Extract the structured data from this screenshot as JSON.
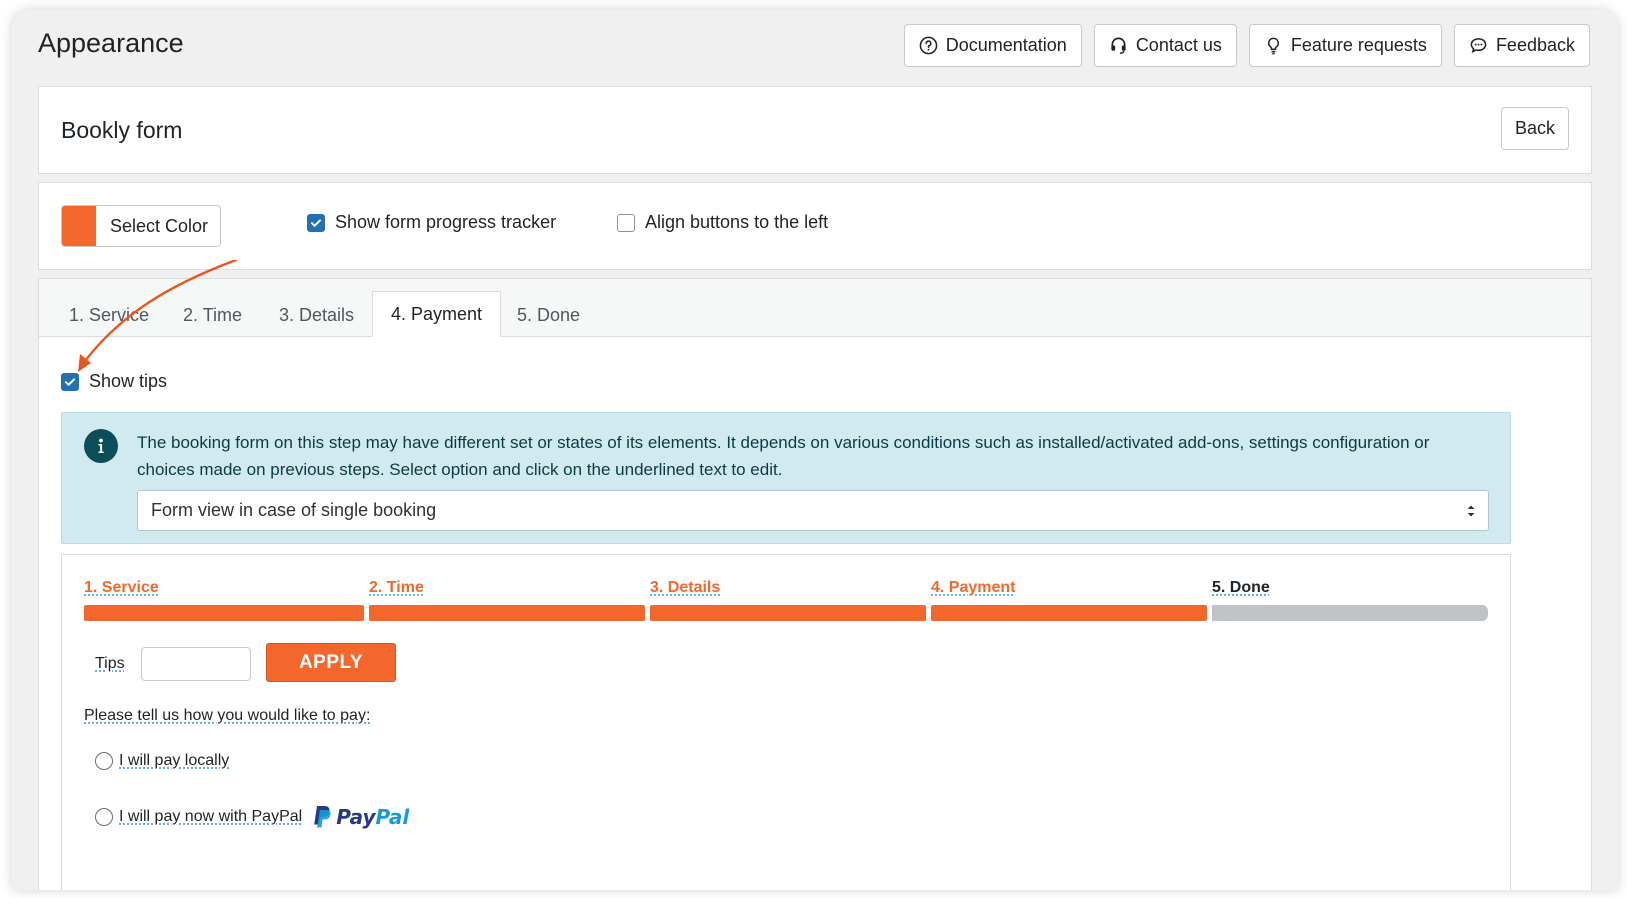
{
  "page": {
    "title": "Appearance"
  },
  "top_buttons": [
    {
      "label": "Documentation",
      "icon": "question-circle-icon"
    },
    {
      "label": "Contact us",
      "icon": "headset-icon"
    },
    {
      "label": "Feature requests",
      "icon": "lightbulb-icon"
    },
    {
      "label": "Feedback",
      "icon": "chat-bubble-icon"
    }
  ],
  "header": {
    "title": "Bookly form",
    "back_label": "Back"
  },
  "options": {
    "select_color_label": "Select Color",
    "accent_color": "#f4672c",
    "show_progress_label": "Show form progress tracker",
    "show_progress_checked": true,
    "align_left_label": "Align buttons to the left",
    "align_left_checked": false
  },
  "tabs": [
    {
      "label": "1. Service"
    },
    {
      "label": "2. Time"
    },
    {
      "label": "3. Details"
    },
    {
      "label": "4. Payment",
      "active": true
    },
    {
      "label": "5. Done"
    }
  ],
  "payment_tab": {
    "show_tips_label": "Show tips",
    "show_tips_checked": true,
    "info_text": "The booking form on this step may have different set or states of its elements. It depends on various conditions such as installed/activated add-ons, settings configuration or choices made on previous steps. Select option and click on the underlined text to edit.",
    "view_select_value": "Form view in case of single booking"
  },
  "preview": {
    "steps": [
      {
        "label": "1. Service",
        "done": true
      },
      {
        "label": "2. Time",
        "done": true
      },
      {
        "label": "3. Details",
        "done": true
      },
      {
        "label": "4. Payment",
        "done": true
      },
      {
        "label": "5. Done",
        "done": false
      }
    ],
    "tips_label": "Tips",
    "tips_value": "",
    "apply_label": "APPLY",
    "pay_prompt": "Please tell us how you would like to pay:",
    "pay_local_label": "I will pay locally",
    "pay_paypal_label": "I will pay now with PayPal",
    "paypal_logo_pay": "Pay",
    "paypal_logo_pal": "Pal"
  },
  "colors": {
    "accent": "#f4672c",
    "inactive_bar": "#bfc3c7",
    "info_bg": "#d1eaef",
    "checkbox_blue": "#2271b1"
  }
}
